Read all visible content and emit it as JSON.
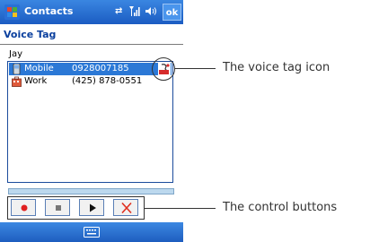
{
  "app": {
    "title": "Contacts",
    "ok_label": "ok",
    "page_heading": "Voice Tag"
  },
  "contact": {
    "name": "Jay",
    "phones": [
      {
        "label": "Mobile",
        "number": "0928007185",
        "selected": true,
        "has_voice_tag": true
      },
      {
        "label": "Work",
        "number": "(425) 878-0551",
        "selected": false,
        "has_voice_tag": false
      }
    ]
  },
  "controls": {
    "buttons": [
      "record-icon",
      "stop-icon",
      "play-icon",
      "delete-icon"
    ]
  },
  "callouts": {
    "voice_tag": "The voice tag icon",
    "controls": "The control buttons"
  },
  "colors": {
    "bar_blue": "#1b5cc2",
    "selection": "#2b78d6",
    "record": "#e02020"
  }
}
